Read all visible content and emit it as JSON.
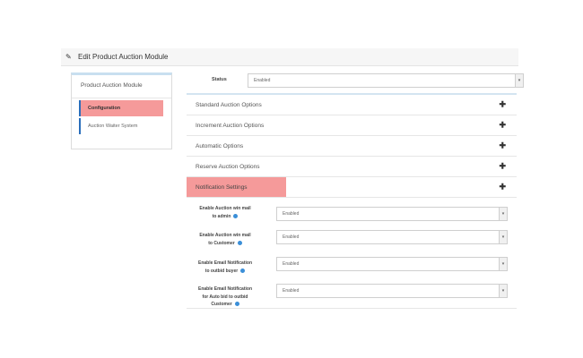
{
  "header": {
    "title": "Edit Product Auction Module"
  },
  "left_panel": {
    "title": "Product Auction Module",
    "items": [
      {
        "label": "Configuration",
        "active": true
      },
      {
        "label": "Auction Waiter System",
        "active": false
      }
    ]
  },
  "status": {
    "label": "Status",
    "value": "Enabled"
  },
  "accordion": [
    {
      "label": "Standard Auction Options"
    },
    {
      "label": "Increment Auction Options"
    },
    {
      "label": "Automatic Options"
    },
    {
      "label": "Reserve Auction Options"
    },
    {
      "label": "Notification Settings",
      "active": true
    }
  ],
  "notification_settings": [
    {
      "label_lines": [
        "Enable Auction win mail",
        "to admin"
      ],
      "value": "Enabled"
    },
    {
      "label_lines": [
        "Enable Auction win mail",
        "to Customer"
      ],
      "value": "Enabled"
    },
    {
      "label_lines": [
        "Enable Email Notification",
        "to outbid buyer"
      ],
      "value": "Enabled"
    },
    {
      "label_lines": [
        "Enable Email Notification",
        "for Auto bid to outbid",
        "Customer"
      ],
      "value": "Enabled"
    }
  ],
  "colors": {
    "highlight": "#f59a9a",
    "accent_blue": "#2a6ebb",
    "info_icon": "#3b8fd8"
  },
  "icons": {
    "header": "pencil-icon",
    "accordion_toggle": "plus-icon",
    "select_toggle": "chevron-down-icon",
    "help": "info-icon"
  }
}
